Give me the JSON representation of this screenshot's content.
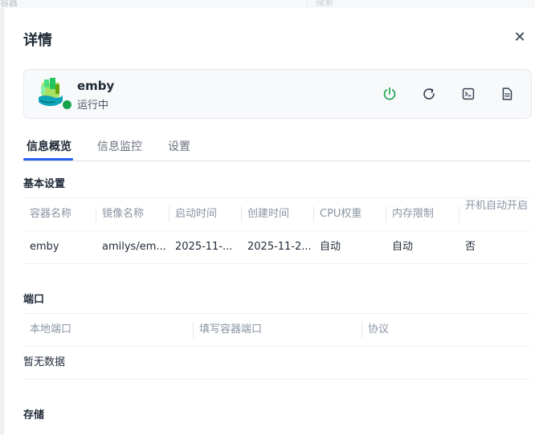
{
  "background": {
    "left_text": "容器",
    "search_placeholder": "搜索"
  },
  "drawer": {
    "title": "详情"
  },
  "container": {
    "name": "emby",
    "status": "运行中",
    "status_color": "#16a34a",
    "actions": [
      {
        "name": "power-icon",
        "color": "#16a34a"
      },
      {
        "name": "restart-icon",
        "color": "#374151"
      },
      {
        "name": "terminal-icon",
        "color": "#374151"
      },
      {
        "name": "log-icon",
        "color": "#374151"
      }
    ]
  },
  "tabs": [
    {
      "label": "信息概览",
      "active": true
    },
    {
      "label": "信息监控",
      "active": false
    },
    {
      "label": "设置",
      "active": false
    }
  ],
  "basic": {
    "title": "基本设置",
    "columns": [
      "容器名称",
      "镜像名称",
      "启动时间",
      "创建时间",
      "CPU权重",
      "内存限制",
      "开机自动开启"
    ],
    "row": [
      "emby",
      "amilys/em...",
      "2025-11-...",
      "2025-11-2...",
      "自动",
      "自动",
      "否"
    ]
  },
  "ports": {
    "title": "端口",
    "columns": [
      "本地端口",
      "填写容器端口",
      "协议"
    ],
    "empty_text": "暂无数据"
  },
  "storage": {
    "title": "存储"
  },
  "accent_color": "#2563eb"
}
